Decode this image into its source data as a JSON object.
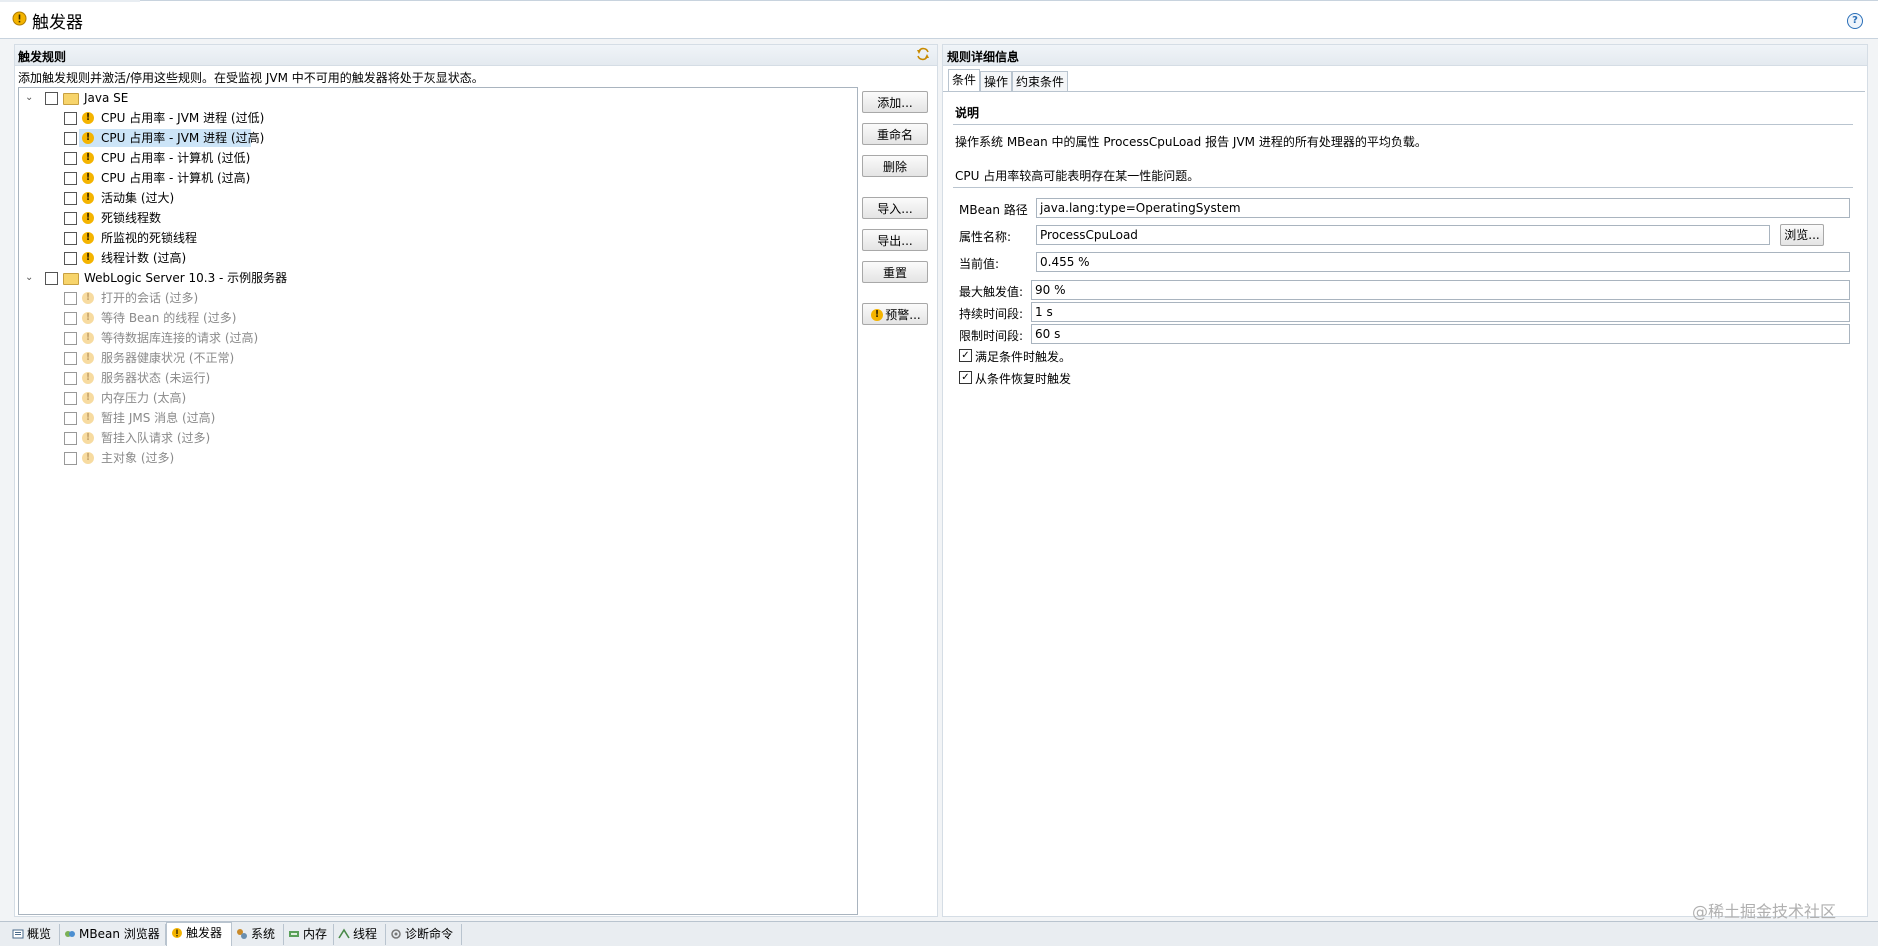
{
  "window": {
    "title": "触发器",
    "help_glyph": "?"
  },
  "left": {
    "section_title": "触发规则",
    "description": "添加触发规则并激活/停用这些规则。在受监视 JVM 中不可用的触发器将处于灰显状态。",
    "tree": {
      "groups": [
        {
          "label": "Java SE",
          "items": [
            "CPU 占用率 - JVM 进程 (过低)",
            "CPU 占用率 - JVM 进程 (过高)",
            "CPU 占用率 - 计算机 (过低)",
            "CPU 占用率 - 计算机 (过高)",
            "活动集 (过大)",
            "死锁线程数",
            "所监视的死锁线程",
            "线程计数 (过高)"
          ]
        },
        {
          "label": "WebLogic Server 10.3 - 示例服务器",
          "items": [
            "打开的会话 (过多)",
            "等待 Bean 的线程 (过多)",
            "等待数据库连接的请求 (过高)",
            "服务器健康状况 (不正常)",
            "服务器状态 (未运行)",
            "内存压力 (太高)",
            "暂挂 JMS 消息 (过高)",
            "暂挂入队请求 (过多)",
            "主对象 (过多)"
          ]
        }
      ]
    },
    "buttons": {
      "add": "添加...",
      "rename": "重命名",
      "delete": "删除",
      "import": "导入...",
      "export": "导出...",
      "reset": "重置",
      "alert": "预警..."
    }
  },
  "right": {
    "section_title": "规则详细信息",
    "tabs": [
      "条件",
      "操作",
      "约束条件"
    ],
    "desc_heading": "说明",
    "desc_line1": "操作系统 MBean 中的属性 ProcessCpuLoad 报告 JVM 进程的所有处理器的平均负载。",
    "desc_line2": "CPU 占用率较高可能表明存在某一性能问题。",
    "fields": {
      "mbean_path_label": "MBean 路径",
      "mbean_path_value": "java.lang:type=OperatingSystem",
      "attr_name_label": "属性名称:",
      "attr_name_value": "ProcessCpuLoad",
      "browse_label": "浏览...",
      "current_label": "当前值:",
      "current_value": "0.455 %",
      "max_label": "最大触发值:",
      "max_value": "90 %",
      "duration_label": "持续时间段:",
      "duration_value": "1 s",
      "limit_label": "限制时间段:",
      "limit_value": "60 s"
    },
    "checks": {
      "on_met": "满足条件时触发。",
      "on_recover": "从条件恢复时触发"
    }
  },
  "bottom_tabs": [
    "概览",
    "MBean 浏览器",
    "触发器",
    "系统",
    "内存",
    "线程",
    "诊断命令"
  ],
  "watermark": "@稀土掘金技术社区",
  "colors": {
    "accent": "#f4b400",
    "selection": "#cce4f7",
    "border": "#a9b4bf"
  }
}
